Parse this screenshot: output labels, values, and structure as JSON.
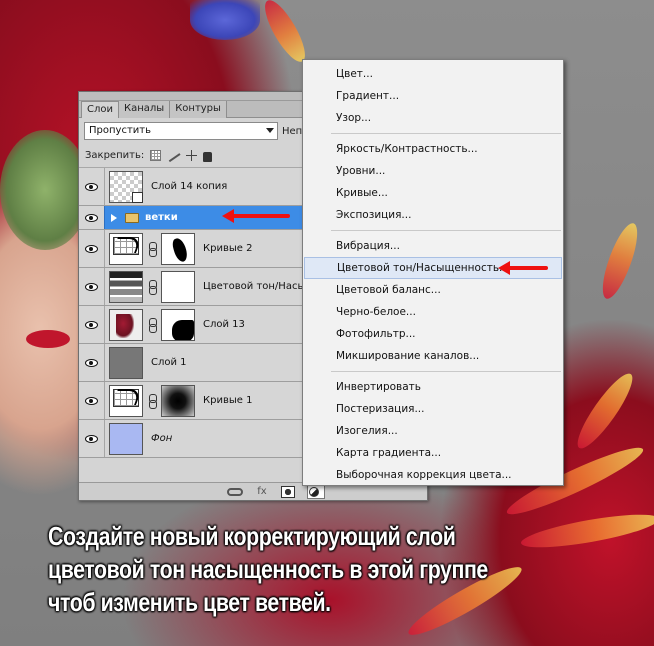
{
  "layers_panel": {
    "tabs": [
      {
        "label": "Слои",
        "active": true
      },
      {
        "label": "Каналы",
        "active": false
      },
      {
        "label": "Контуры",
        "active": false
      }
    ],
    "blend_mode": "Пропустить",
    "opacity_label": "Неп",
    "lock_label": "Закрепить:",
    "layers": [
      {
        "name": "Слой 14 копия",
        "thumb": "checker",
        "smart_object": true,
        "italic": false
      },
      {
        "name": "ветки",
        "type": "group",
        "selected": true
      },
      {
        "name": "Кривые 2",
        "thumb": "curves",
        "mask": "blob",
        "italic": false
      },
      {
        "name": "Цветовой тон/Насыщенность",
        "thumb": "huesat",
        "mask": "white",
        "italic": false
      },
      {
        "name": "Слой 13",
        "thumb": "photo",
        "mask": "black-white",
        "italic": false
      },
      {
        "name": "Слой 1",
        "thumb": "gray",
        "italic": false
      },
      {
        "name": "Кривые 1",
        "thumb": "curves",
        "mask": "radial",
        "italic": false
      },
      {
        "name": "Фон",
        "thumb": "blue",
        "italic": true
      }
    ],
    "bottom_icons": [
      "link-icon",
      "fx-icon",
      "add-mask-icon",
      "adjustment-layer-icon",
      "group-icon",
      "new-layer-icon",
      "trash-icon"
    ],
    "fx_label": "fx"
  },
  "adjustment_menu": {
    "groups": [
      [
        "Цвет...",
        "Градиент...",
        "Узор..."
      ],
      [
        "Яркость/Контрастность...",
        "Уровни...",
        "Кривые...",
        "Экспозиция..."
      ],
      [
        "Вибрация...",
        "Цветовой тон/Насыщенность...",
        "Цветовой баланс...",
        "Черно-белое...",
        "Фотофильтр...",
        "Микширование каналов..."
      ],
      [
        "Инвертировать",
        "Постеризация...",
        "Изогелия...",
        "Карта градиента...",
        "Выборочная коррекция цвета..."
      ]
    ],
    "highlighted": "Цветовой тон/Насыщенность..."
  },
  "caption": {
    "lines": [
      "Создайте новый корректирующий слой",
      "цветовой тон насыщенность  в этой группе",
      "чтоб изменить цвет ветвей."
    ]
  },
  "colors": {
    "accent_selected": "#3d8ce6",
    "arrow": "#ee1111",
    "menu_highlight": "#dfe8f6"
  }
}
